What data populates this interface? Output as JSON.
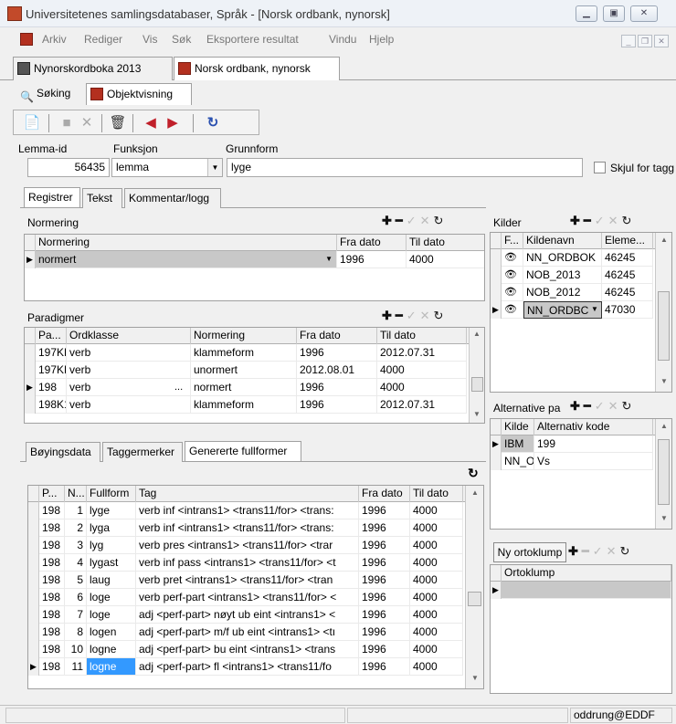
{
  "window": {
    "title": "Universitetenes samlingsdatabaser, Språk - [Norsk ordbank, nynorsk]"
  },
  "menu": [
    "Arkiv",
    "Rediger",
    "Vis",
    "Søk",
    "Eksportere resultat",
    "Vindu",
    "Hjelp"
  ],
  "doc_tabs": [
    "Nynorskordboka 2013",
    "Norsk ordbank, nynorsk"
  ],
  "view_tabs": [
    "Søking",
    "Objektvisning"
  ],
  "form": {
    "lemma_id_label": "Lemma-id",
    "lemma_id": "56435",
    "funksjon_label": "Funksjon",
    "funksjon": "lemma",
    "grunnform_label": "Grunnform",
    "grunnform": "lyge",
    "skjul_label": "Skjul for tagg"
  },
  "section_tabs": [
    "Registrer",
    "Tekst",
    "Kommentar/logg"
  ],
  "normering": {
    "title": "Normering",
    "headers": [
      "Normering",
      "Fra dato",
      "Til dato"
    ],
    "rows": [
      [
        "normert",
        "1996",
        "4000"
      ]
    ]
  },
  "paradigmer": {
    "title": "Paradigmer",
    "headers": [
      "Pa...",
      "Ordklasse",
      "Normering",
      "Fra dato",
      "Til dato"
    ],
    "rows": [
      [
        "197KL",
        "verb",
        "klammeform",
        "1996",
        "2012.07.31"
      ],
      [
        "197KL",
        "verb",
        "unormert",
        "2012.08.01",
        "4000"
      ],
      [
        "198",
        "verb",
        "normert",
        "1996",
        "4000"
      ],
      [
        "198K1",
        "verb",
        "klammeform",
        "1996",
        "2012.07.31"
      ]
    ],
    "ellipsis": "..."
  },
  "bottom_tabs": [
    "Bøyingsdata",
    "Taggermerker",
    "Genererte fullformer"
  ],
  "fullformer": {
    "headers": [
      "P...",
      "N...",
      "Fullform",
      "Tag",
      "Fra dato",
      "Til dato"
    ],
    "rows": [
      [
        "198",
        "1",
        "lyge",
        "verb inf <intrans1> <trans11/for> <trans:",
        "1996",
        "4000"
      ],
      [
        "198",
        "2",
        "lyga",
        "verb inf <intrans1> <trans11/for> <trans:",
        "1996",
        "4000"
      ],
      [
        "198",
        "3",
        "lyg",
        "verb pres <intrans1> <trans11/for> <trar",
        "1996",
        "4000"
      ],
      [
        "198",
        "4",
        "lygast",
        "verb inf pass <intrans1> <trans11/for> <t",
        "1996",
        "4000"
      ],
      [
        "198",
        "5",
        "laug",
        "verb pret <intrans1> <trans11/for> <tran",
        "1996",
        "4000"
      ],
      [
        "198",
        "6",
        "loge",
        "verb perf-part <intrans1> <trans11/for> <",
        "1996",
        "4000"
      ],
      [
        "198",
        "7",
        "loge",
        "adj <perf-part> nøyt ub eint <intrans1> <",
        "1996",
        "4000"
      ],
      [
        "198",
        "8",
        "logen",
        "adj <perf-part> m/f ub eint <intrans1> <tı",
        "1996",
        "4000"
      ],
      [
        "198",
        "10",
        "logne",
        "adj <perf-part> bu eint <intrans1> <trans",
        "1996",
        "4000"
      ],
      [
        "198",
        "11",
        "logne",
        "adj <perf-part> fl <intrans1> <trans11/fo",
        "1996",
        "4000"
      ]
    ]
  },
  "kilder": {
    "title": "Kilder",
    "headers": [
      "F...",
      "Kildenavn",
      "Eleme..."
    ],
    "rows": [
      [
        "NN_ORDBOK",
        "46245"
      ],
      [
        "NOB_2013",
        "46245"
      ],
      [
        "NOB_2012",
        "46245"
      ],
      [
        "NN_ORDBC",
        "47030"
      ]
    ]
  },
  "alternative": {
    "title": "Alternative pa",
    "headers": [
      "Kilde",
      "Alternativ kode"
    ],
    "rows": [
      [
        "IBM",
        "199"
      ],
      [
        "NN_O",
        "Vs"
      ]
    ]
  },
  "ortoklump": {
    "button": "Ny ortoklump",
    "header": "Ortoklump"
  },
  "status": {
    "user": "oddrung@EDDF"
  }
}
